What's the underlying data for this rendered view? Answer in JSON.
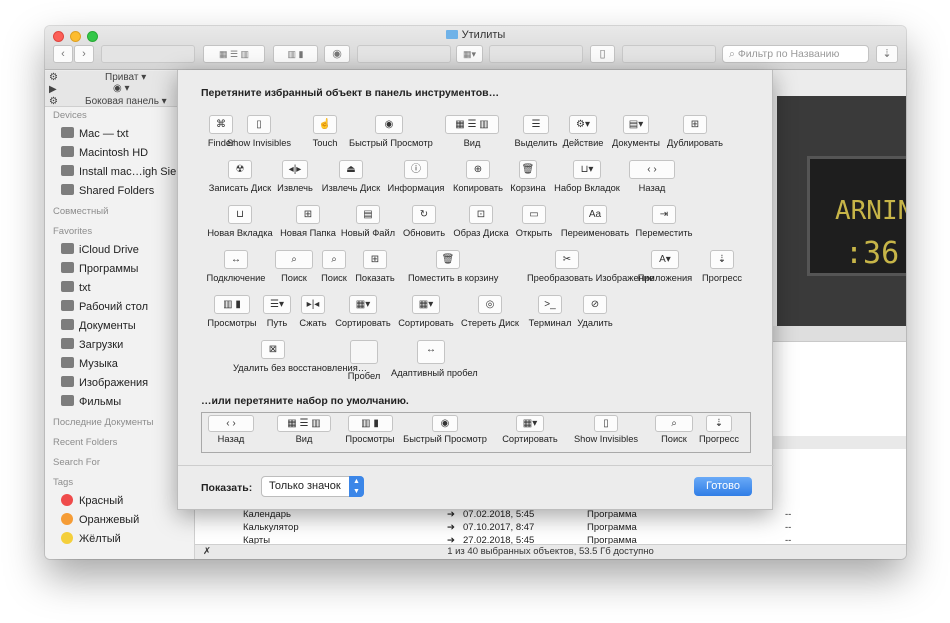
{
  "window": {
    "title": "Утилиты"
  },
  "toolbar": {
    "back": "‹",
    "forward": "›",
    "filter_placeholder": "Фильтр по Названию",
    "download": "⇣"
  },
  "topstrip": {
    "privat": "Приват",
    "sidebar": "Боковая панель"
  },
  "sidebar": {
    "devices_head": "Devices",
    "devices": [
      "Mac — txt",
      "Macintosh HD",
      "Install mac…igh Sierra",
      "Shared Folders"
    ],
    "shared_head": "Совместный",
    "favorites_head": "Favorites",
    "favorites": [
      "iCloud Drive",
      "Программы",
      "txt",
      "Рабочий стол",
      "Документы",
      "Загрузки",
      "Музыка",
      "Изображения",
      "Фильмы"
    ],
    "recent_docs_head": "Последние Документы",
    "recent_folders_head": "Recent Folders",
    "search_head": "Search For",
    "tags_head": "Tags",
    "tags": [
      {
        "label": "Красный",
        "color": "#ef4b4b"
      },
      {
        "label": "Оранжевый",
        "color": "#f59c36"
      },
      {
        "label": "Жёлтый",
        "color": "#f4cf3b"
      }
    ]
  },
  "files": [
    {
      "name": "Календарь",
      "date": "07.02.2018, 5:45",
      "kind": "Программа",
      "size": "--"
    },
    {
      "name": "Калькулятор",
      "date": "07.10.2017, 8:47",
      "kind": "Программа",
      "size": "--"
    },
    {
      "name": "Карты",
      "date": "27.02.2018, 5:45",
      "kind": "Программа",
      "size": "--"
    }
  ],
  "status": "1 из 40 выбранных объектов, 53.5 Гб доступно",
  "preview_text": {
    "line1": "ARNIN",
    "line2": ":36"
  },
  "sheet": {
    "title": "Перетяните избранный объект в панель инструментов…",
    "tools": [
      {
        "label": "Finder",
        "glyph": "⌘"
      },
      {
        "label": "Show Invisibles",
        "glyph": "▯"
      },
      {
        "label": "Touch",
        "glyph": "☝"
      },
      {
        "label": "Быстрый Просмотр",
        "glyph": "◉"
      },
      {
        "label": "Вид",
        "glyph": "▦  ☰  ▥"
      },
      {
        "label": "Выделить",
        "glyph": "☰"
      },
      {
        "label": "Действие",
        "glyph": "⚙▾"
      },
      {
        "label": "Документы",
        "glyph": "▤▾"
      },
      {
        "label": "Дублировать",
        "glyph": "⊞"
      },
      {
        "label": "Записать Диск",
        "glyph": "☢"
      },
      {
        "label": "Извлечь",
        "glyph": "◂|▸"
      },
      {
        "label": "Извлечь Диск",
        "glyph": "⏏"
      },
      {
        "label": "Информация",
        "glyph": "ⓘ"
      },
      {
        "label": "Копировать",
        "glyph": "⊕"
      },
      {
        "label": "Корзина",
        "glyph": "🗑"
      },
      {
        "label": "Набор Вкладок",
        "glyph": "⊔▾"
      },
      {
        "label": "Назад",
        "glyph": "‹  ›"
      },
      {
        "label": "Новая Вкладка",
        "glyph": "⊔"
      },
      {
        "label": "Новая Папка",
        "glyph": "⊞"
      },
      {
        "label": "Новый Файл",
        "glyph": "▤"
      },
      {
        "label": "Обновить",
        "glyph": "↻"
      },
      {
        "label": "Образ Диска",
        "glyph": "⊡"
      },
      {
        "label": "Открыть",
        "glyph": "▭"
      },
      {
        "label": "Переименовать",
        "glyph": "Aa"
      },
      {
        "label": "Переместить",
        "glyph": "⇥"
      },
      {
        "label": "Подключение",
        "glyph": "↔"
      },
      {
        "label": "Поиск",
        "glyph": "⌕"
      },
      {
        "label": "Поиск",
        "glyph": "⌕"
      },
      {
        "label": "Показать",
        "glyph": "⊞"
      },
      {
        "label": "Поместить в корзину",
        "glyph": "🗑"
      },
      {
        "label": "Преобразовать Изображение",
        "glyph": "✂"
      },
      {
        "label": "Приложения",
        "glyph": "A▾"
      },
      {
        "label": "Прогресс",
        "glyph": "⇣"
      },
      {
        "label": "Просмотры",
        "glyph": "▥ ▮"
      },
      {
        "label": "Путь",
        "glyph": "☰▾"
      },
      {
        "label": "Сжать",
        "glyph": "▸|◂"
      },
      {
        "label": "Сортировать",
        "glyph": "▦▾"
      },
      {
        "label": "Сортировать",
        "glyph": "▦▾"
      },
      {
        "label": "Стереть Диск",
        "glyph": "◎"
      },
      {
        "label": "Терминал",
        "glyph": ">_"
      },
      {
        "label": "Удалить",
        "glyph": "⊘"
      },
      {
        "label": "Удалить без восстановления…",
        "glyph": "⊠"
      },
      {
        "label": "Пробел",
        "glyph": ""
      },
      {
        "label": "Адаптивный пробел",
        "glyph": "↔"
      }
    ],
    "default_title": "…или перетяните набор по умолчанию.",
    "default_set": [
      {
        "label": "Назад",
        "glyph": "‹  ›"
      },
      {
        "label": "Вид",
        "glyph": "▦  ☰  ▥"
      },
      {
        "label": "Просмотры",
        "glyph": "▥ ▮"
      },
      {
        "label": "Быстрый Просмотр",
        "glyph": "◉"
      },
      {
        "label": "Сортировать",
        "glyph": "▦▾"
      },
      {
        "label": "Show Invisibles",
        "glyph": "▯"
      },
      {
        "label": "Поиск",
        "glyph": "⌕"
      },
      {
        "label": "Прогресс",
        "glyph": "⇣"
      }
    ],
    "show_label": "Показать:",
    "show_value": "Только значок",
    "done_label": "Готово"
  }
}
